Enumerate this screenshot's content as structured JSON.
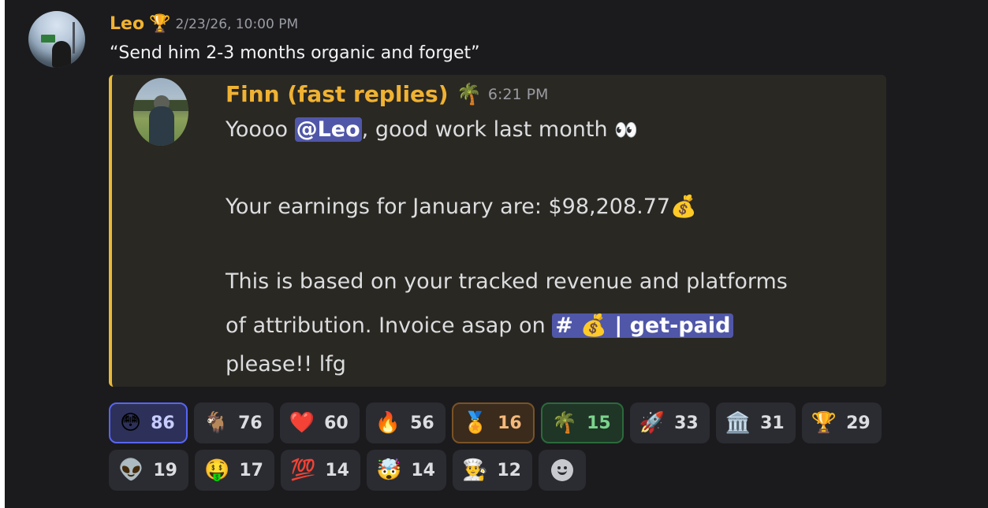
{
  "message": {
    "author": "Leo",
    "author_badge_icon": "trophy-icon",
    "timestamp": "2/23/26, 10:00 PM",
    "text": "“Send him 2-3 months organic and forget”"
  },
  "embed": {
    "accent_color": "#e8b93a",
    "author": "Finn (fast replies)",
    "author_emoji": "🌴",
    "time": "6:21 PM",
    "line1_before": "Yoooo ",
    "mention": "@Leo",
    "line1_after": ", good work last month ",
    "eyes": "👀",
    "line2": "Your earnings for January are: $98,208.77",
    "moneybag": "💰",
    "line3": "This is based on your tracked revenue and platforms",
    "line4_before": "of attribution. Invoice asap on ",
    "channel": "# 💰 | get-paid",
    "line5": "please!! lfg"
  },
  "reactions": {
    "row1": [
      {
        "emoji": "😳",
        "count": "86",
        "style": "blue"
      },
      {
        "emoji": "🐐",
        "count": "76",
        "style": "default"
      },
      {
        "emoji": "❤️",
        "count": "60",
        "style": "default"
      },
      {
        "emoji": "🔥",
        "count": "56",
        "style": "default"
      },
      {
        "emoji": "🏅",
        "count": "16",
        "style": "orange"
      },
      {
        "emoji": "🌴",
        "count": "15",
        "style": "green"
      },
      {
        "emoji": "🚀",
        "count": "33",
        "style": "default"
      },
      {
        "emoji": "🏛️",
        "count": "31",
        "style": "default"
      },
      {
        "emoji": "🏆",
        "count": "29",
        "style": "default"
      }
    ],
    "row2": [
      {
        "emoji": "👽",
        "count": "19",
        "style": "default"
      },
      {
        "emoji": "🤑",
        "count": "17",
        "style": "default"
      },
      {
        "emoji": "💯",
        "count": "14",
        "style": "default"
      },
      {
        "emoji": "🤯",
        "count": "14",
        "style": "default"
      },
      {
        "emoji": "👨‍🍳",
        "count": "12",
        "style": "default"
      }
    ],
    "add_icon": "add-reaction-smiley-icon"
  }
}
